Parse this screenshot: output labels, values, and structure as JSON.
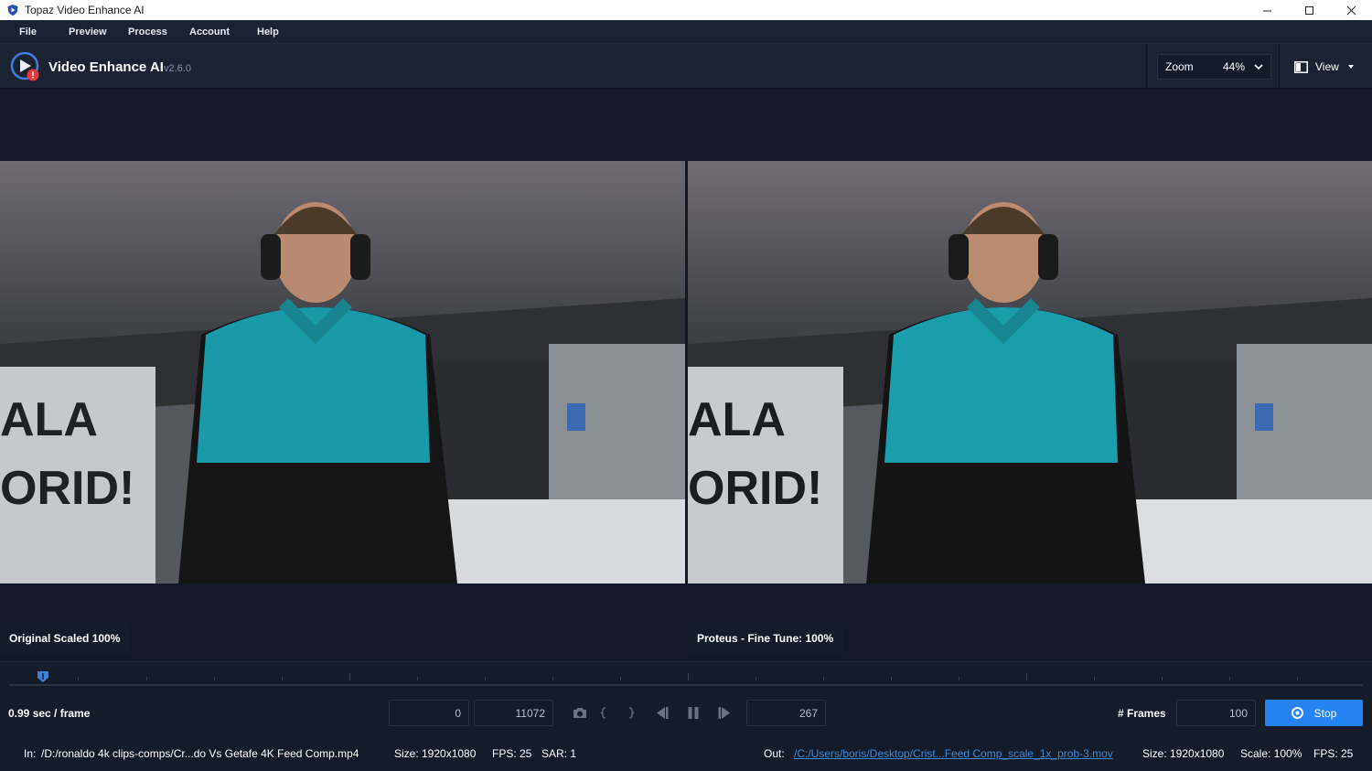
{
  "window": {
    "title": "Topaz Video Enhance AI"
  },
  "menu": [
    "File",
    "Preview",
    "Process",
    "Account",
    "Help"
  ],
  "header": {
    "app_name": "Video Enhance AI",
    "version": "v2.6.0",
    "zoom_label": "Zoom",
    "zoom_value": "44%",
    "view_label": "View"
  },
  "preview": {
    "left_label": "Original Scaled 100%",
    "right_label": "Proteus - Fine Tune: 100%"
  },
  "controls": {
    "speed": "0.99 sec / frame",
    "range_start": "0",
    "range_end": "11072",
    "current_frame": "267",
    "frames_label": "# Frames",
    "frames_value": "100",
    "stop_label": "Stop"
  },
  "status": {
    "in_label": "In:",
    "in_path": "/D:/ronaldo 4k clips-comps/Cr...do Vs Getafe 4K Feed Comp.mp4",
    "in_size": "Size: 1920x1080",
    "in_fps": "FPS: 25",
    "in_sar": "SAR: 1",
    "out_label": "Out:",
    "out_path": "/C:/Users/boris/Desktop/Crist...Feed Comp_scale_1x_prob-3.mov",
    "out_size": "Size: 1920x1080",
    "out_scale": "Scale: 100%",
    "out_fps": "FPS: 25"
  },
  "colors": {
    "accent": "#2584f2",
    "background": "#141b29",
    "link": "#3d8bd8"
  }
}
